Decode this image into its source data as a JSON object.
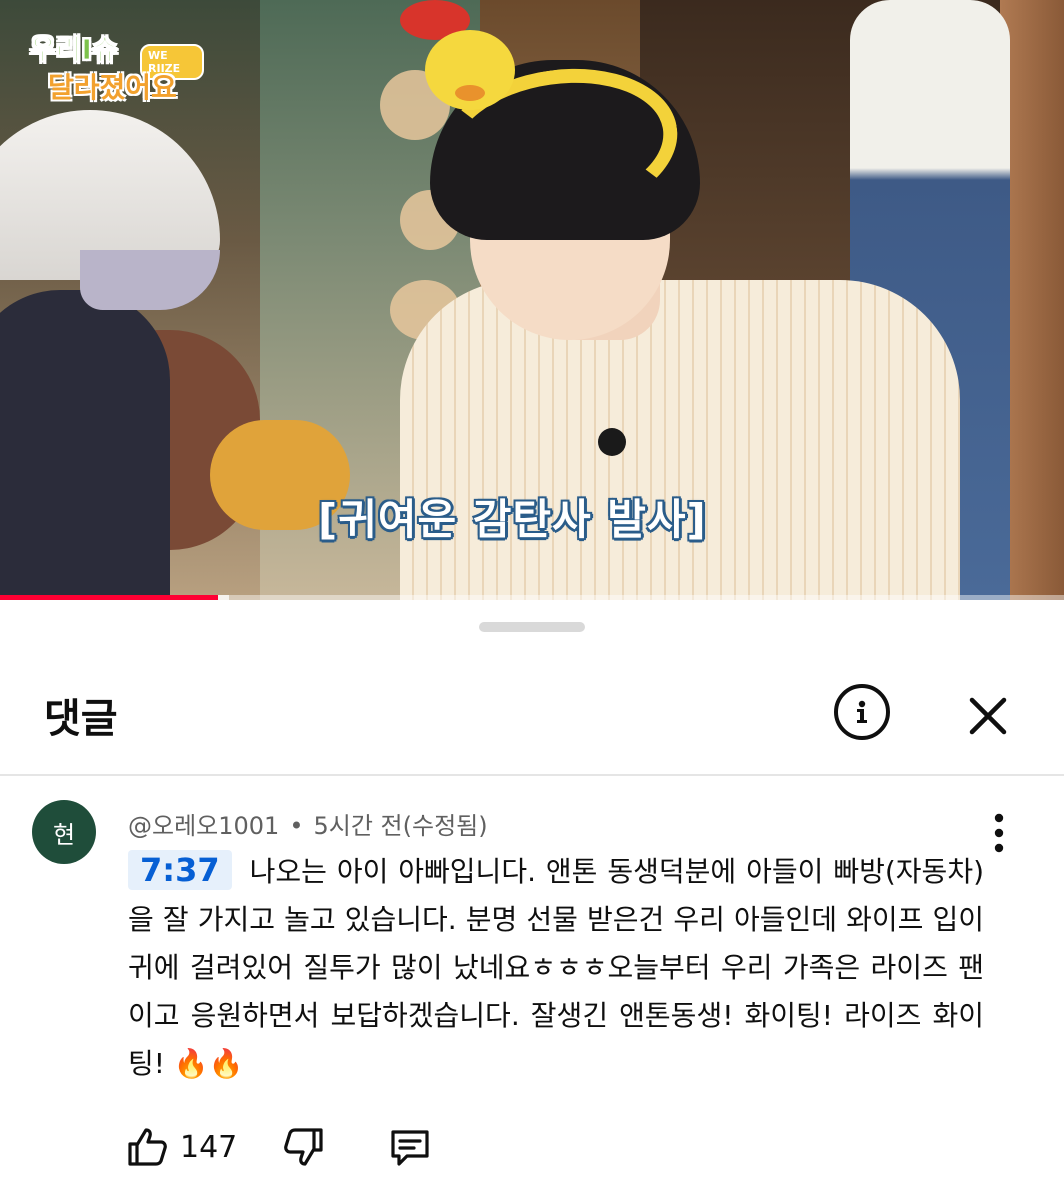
{
  "video": {
    "logo": {
      "line1": "우리I슈",
      "line2": "달라졌어요",
      "badge": "WE RIIZE"
    },
    "subtitle": "[귀여운 감탄사 발사]",
    "progress": 0.205,
    "buffered": 0.215
  },
  "comments_panel": {
    "title": "댓글",
    "info_icon": "info-circle",
    "close_icon": "close-x"
  },
  "comment": {
    "avatar_letter": "현",
    "author": "@오레오1001",
    "separator": "•",
    "time": "5시간 전(수정됨)",
    "timestamp": "7:37",
    "text": "나오는 아이 아빠입니다. 앤톤 동생덕분에 아들이 빠방(자동차)을 잘 가지고 놀고 있습니다. 분명 선물 받은건 우리 아들인데 와이프 입이 귀에 걸려있어 질투가 많이 났네요ㅎㅎㅎ오늘부터 우리 가족은 라이즈 팬이고 응원하면서 보답하겠습니다. 잘생긴 앤톤동생! 화이팅! 라이즈 화이팅!",
    "emoji": "🔥🔥",
    "like_count": "147",
    "icons": [
      "thumbs-up-icon",
      "thumbs-down-icon",
      "reply-icon",
      "more-vertical-icon"
    ]
  },
  "colors": {
    "accent": "#065fd4",
    "progress": "#ff0033",
    "avatar_bg": "#1f4d3a"
  }
}
